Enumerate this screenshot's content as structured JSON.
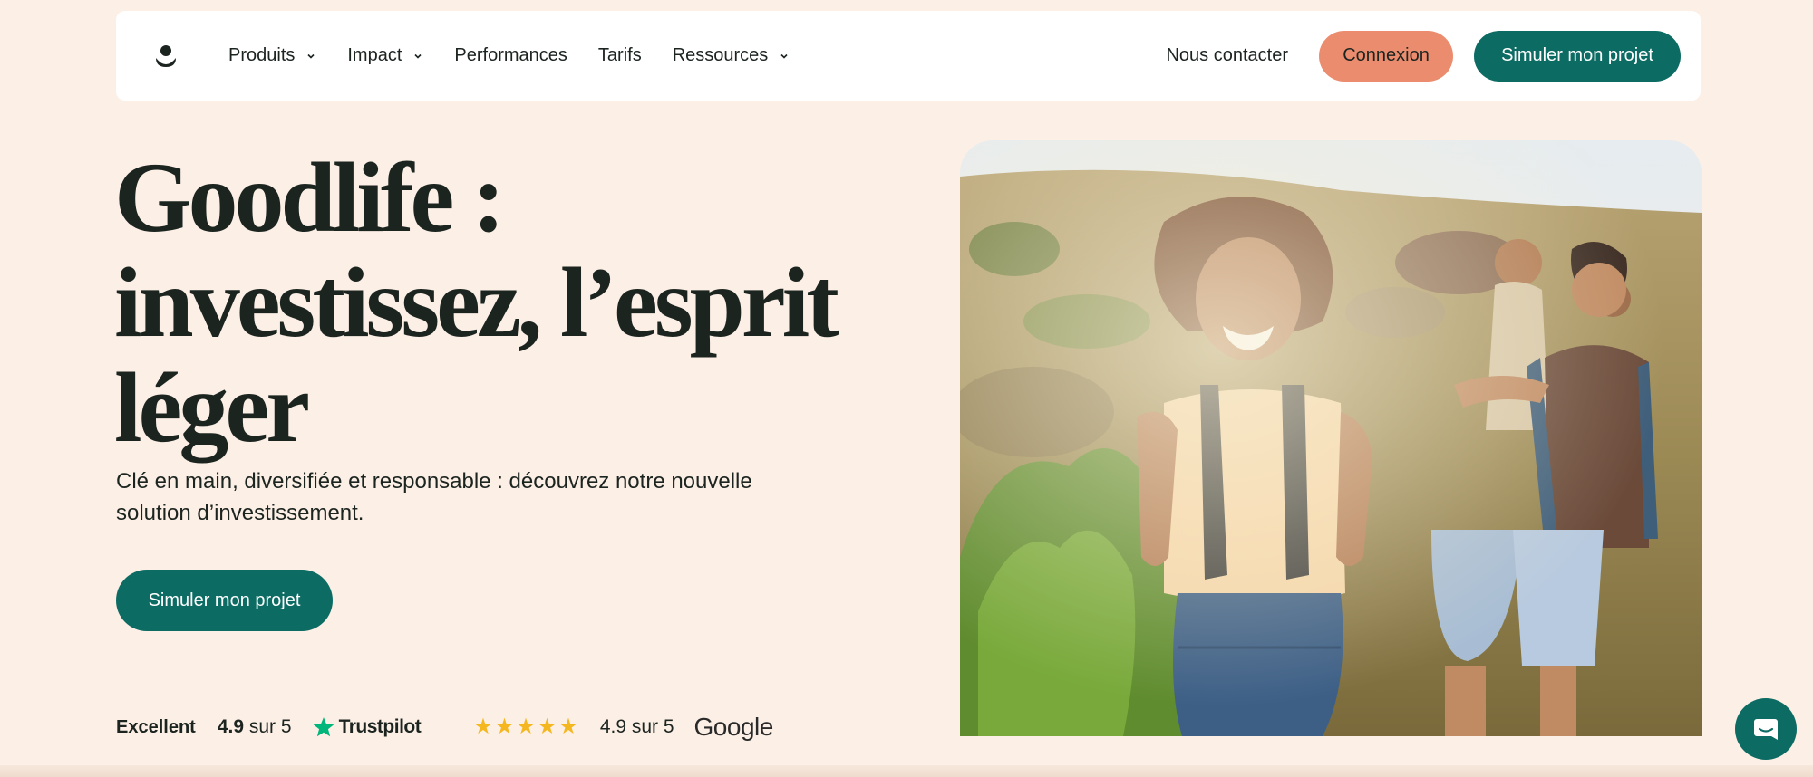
{
  "nav": {
    "logo_icon": "goodlife-logo-icon",
    "items": [
      {
        "label": "Produits",
        "has_dropdown": true
      },
      {
        "label": "Impact",
        "has_dropdown": true
      },
      {
        "label": "Performances",
        "has_dropdown": false
      },
      {
        "label": "Tarifs",
        "has_dropdown": false
      },
      {
        "label": "Ressources",
        "has_dropdown": true
      }
    ],
    "contact_label": "Nous contacter",
    "login_label": "Connexion",
    "simulate_label": "Simuler mon projet"
  },
  "hero": {
    "title_line1": "Goodlife :",
    "title_line2": "investissez, l’esprit",
    "title_line3": "léger",
    "subtitle_line1": "Clé en main, diversifiée et responsable : découvrez notre nouvelle",
    "subtitle_line2": "solution d’investissement.",
    "cta_label": "Simuler mon projet"
  },
  "ratings": {
    "trustpilot": {
      "label": "Excellent",
      "score": "4.9",
      "suffix": "sur 5",
      "brand": "Trustpilot",
      "icon": "trustpilot-star-icon"
    },
    "google": {
      "stars": 5,
      "score_text": "4.9 sur 5",
      "brand": "Google"
    }
  },
  "colors": {
    "background": "#fcefe6",
    "primary_green": "#0c6b63",
    "login_orange": "#ec8c6e",
    "star_yellow": "#f5b720",
    "trustpilot_green": "#00b67a"
  },
  "chat": {
    "icon": "chat-bubble-icon"
  }
}
